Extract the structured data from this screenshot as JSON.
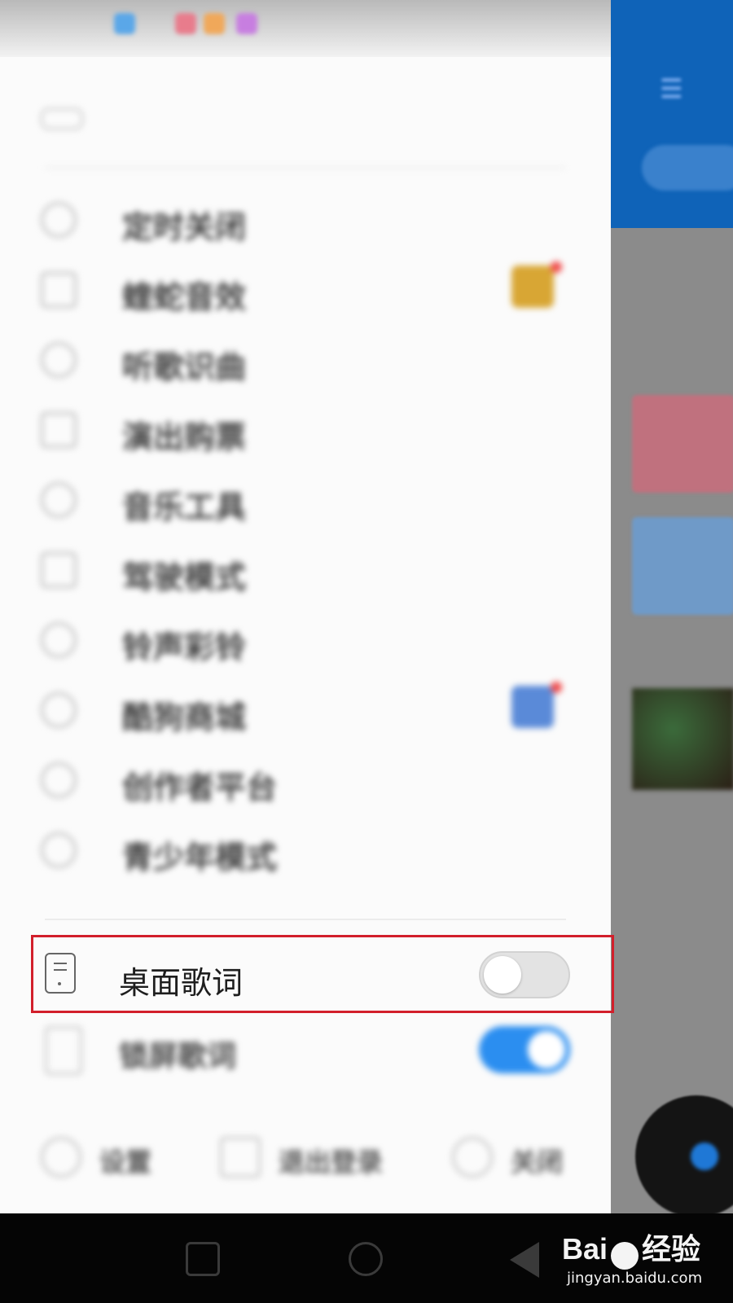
{
  "drawer": {
    "account_label": "",
    "menu_items": [
      {
        "label": "定时关闭",
        "hint": ""
      },
      {
        "label": "蝰蛇音效",
        "hint": ""
      },
      {
        "label": "听歌识曲",
        "hint": ""
      },
      {
        "label": "演出购票",
        "hint": ""
      },
      {
        "label": "音乐工具",
        "hint": ""
      },
      {
        "label": "驾驶模式",
        "hint": ""
      },
      {
        "label": "铃声彩铃",
        "hint": ""
      },
      {
        "label": "酷狗商城",
        "hint": ""
      },
      {
        "label": "创作者平台",
        "hint": ""
      },
      {
        "label": "青少年模式",
        "hint": ""
      }
    ],
    "desktop_lyrics": {
      "label": "桌面歌词",
      "enabled": false
    },
    "lockscreen_lyrics": {
      "label": "锁屏歌词",
      "enabled": true
    },
    "footer": {
      "settings": "设置",
      "logout": "退出登录",
      "close": "关闭"
    }
  },
  "watermark": {
    "brand": "Bai",
    "brand_suffix": "经验",
    "url": "jingyan.baidu.com"
  },
  "colors": {
    "highlight_border": "#d21f2b",
    "toggle_on": "#2b8ef0",
    "header_blue": "#0f63b8"
  }
}
